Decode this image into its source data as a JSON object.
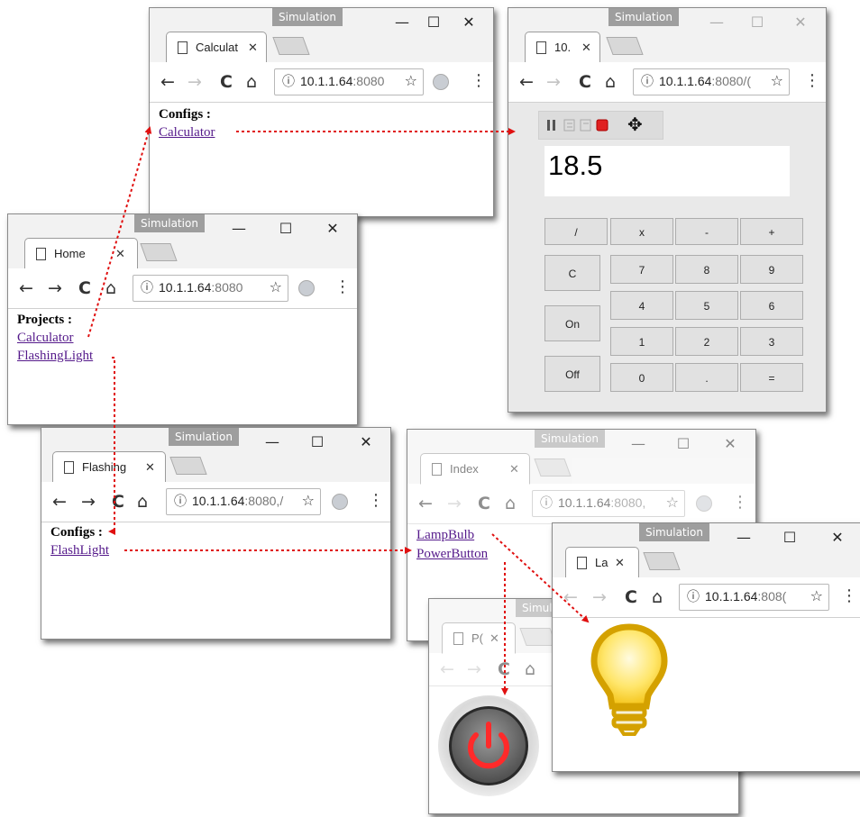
{
  "sim_label": "Simulation",
  "win_controls": {
    "minimize": "—",
    "maximize": "☐",
    "close": "✕"
  },
  "nav": {
    "back": "←",
    "forward": "→",
    "reload": "C",
    "home": "⌂",
    "info": "ⓘ",
    "star": "☆",
    "menu": "⋮"
  },
  "tab_close": "✕",
  "home_window": {
    "tab_title": "Home",
    "url_host": "10.1.1.64",
    "url_rest": ":8080",
    "heading": "Projects :",
    "links": [
      "Calculator",
      "FlashingLight"
    ]
  },
  "calc_config_window": {
    "tab_title": "Calculat",
    "url_host": "10.1.1.64",
    "url_rest": ":8080",
    "heading": "Configs :",
    "links": [
      "Calculator"
    ]
  },
  "calc_app_window": {
    "tab_title": "10.",
    "url_host": "10.1.1.64",
    "url_rest": ":8080/(",
    "display": "18.5",
    "sim_icons": {
      "pause": "pause-icon",
      "step_back": "step-back-icon",
      "step": "step-icon",
      "stop": "stop-icon",
      "move": "move-icon"
    },
    "move_glyph": "✥",
    "ops": [
      "/",
      "x",
      "-",
      "+"
    ],
    "side_keys": [
      "C",
      "On",
      "Off"
    ],
    "digits": [
      "7",
      "8",
      "9",
      "4",
      "5",
      "6",
      "1",
      "2",
      "3",
      "0",
      ".",
      "="
    ]
  },
  "flashing_window": {
    "tab_title": "Flashing",
    "url_host": "10.1.1.64",
    "url_rest": ":8080,/",
    "heading": "Configs :",
    "links": [
      "FlashLight"
    ]
  },
  "index_window": {
    "tab_title": "Index",
    "url_host": "10.1.1.64",
    "url_rest": ":8080,",
    "links": [
      "LampBulb",
      "PowerButton"
    ]
  },
  "lamp_window": {
    "tab_title": "La",
    "url_host": "10.1.1.64",
    "url_rest": ":808(",
    "icon": "light-bulb-icon"
  },
  "power_window": {
    "tab_title": "P(",
    "sim_label": "Simul",
    "icon": "power-button-icon"
  },
  "colors": {
    "arrow": "#e01010",
    "link": "#551a8b",
    "sim_label_bg": "#9e9e9e",
    "stop": "#e02020"
  }
}
